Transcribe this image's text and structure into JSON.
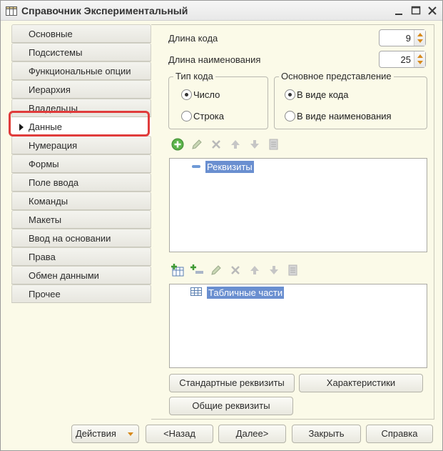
{
  "window": {
    "title": "Справочник Экспериментальный"
  },
  "nav": {
    "items": [
      {
        "label": "Основные"
      },
      {
        "label": "Подсистемы"
      },
      {
        "label": "Функциональные опции"
      },
      {
        "label": "Иерархия"
      },
      {
        "label": "Владельцы"
      },
      {
        "label": "Данные"
      },
      {
        "label": "Нумерация"
      },
      {
        "label": "Формы"
      },
      {
        "label": "Поле ввода"
      },
      {
        "label": "Команды"
      },
      {
        "label": "Макеты"
      },
      {
        "label": "Ввод на основании"
      },
      {
        "label": "Права"
      },
      {
        "label": "Обмен данными"
      },
      {
        "label": "Прочее"
      }
    ],
    "active": "Данные"
  },
  "fields": {
    "code_length_label": "Длина кода",
    "code_length_value": "9",
    "name_length_label": "Длина наименования",
    "name_length_value": "25"
  },
  "code_type": {
    "title": "Тип кода",
    "options": [
      "Число",
      "Строка"
    ],
    "selected": "Число"
  },
  "main_presentation": {
    "title": "Основное представление",
    "options": [
      "В виде кода",
      "В виде наименования"
    ],
    "selected": "В виде кода"
  },
  "attributes_tree": {
    "root_label": "Реквизиты"
  },
  "tabular_tree": {
    "root_label": "Табличные части"
  },
  "buttons": {
    "standard_attributes": "Стандартные реквизиты",
    "characteristics": "Характеристики",
    "common_attributes": "Общие реквизиты"
  },
  "footer": {
    "actions": "Действия",
    "back": "<Назад",
    "next": "Далее>",
    "close": "Закрыть",
    "help": "Справка"
  },
  "colors": {
    "window_bg": "#fbfae8",
    "selection": "#6a8fd0",
    "highlight": "#e03c3c",
    "accent_arrow": "#d78a1c"
  },
  "icons": {
    "title": "table-icon",
    "toolbar1": [
      "add-icon",
      "edit-icon",
      "delete-icon",
      "move-up-icon",
      "move-down-icon",
      "sort-icon"
    ],
    "toolbar2": [
      "add-table-icon",
      "add-row-icon",
      "edit-icon",
      "delete-icon",
      "move-up-icon",
      "move-down-icon",
      "sort-icon"
    ]
  }
}
